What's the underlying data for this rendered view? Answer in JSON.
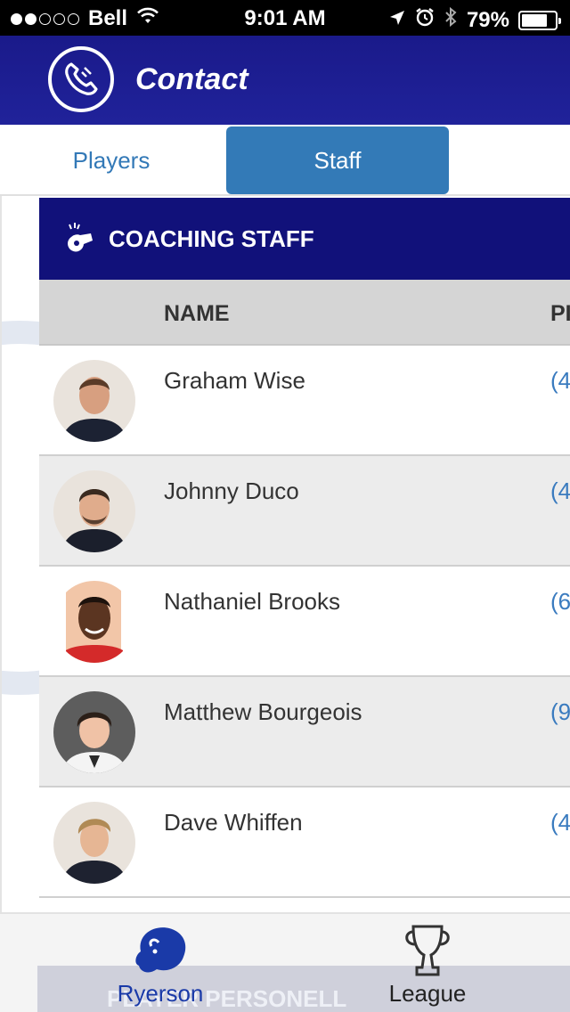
{
  "status_bar": {
    "carrier": "Bell",
    "time": "9:01 AM",
    "battery": "79%",
    "battery_level": 0.79
  },
  "header": {
    "title": "Contact",
    "icon": "phone-icon"
  },
  "tabs": [
    {
      "label": "Players",
      "active": false
    },
    {
      "label": "Staff",
      "active": true
    }
  ],
  "section": {
    "title": "COACHING STAFF",
    "icon": "whistle-icon"
  },
  "table": {
    "columns": [
      "NAME",
      "PI"
    ],
    "rows": [
      {
        "name": "Graham Wise",
        "phone": "(4"
      },
      {
        "name": "Johnny Duco",
        "phone": "(4"
      },
      {
        "name": "Nathaniel Brooks",
        "phone": "(6"
      },
      {
        "name": "Matthew Bourgeois",
        "phone": "(9"
      },
      {
        "name": "Dave Whiffen",
        "phone": "(4"
      }
    ]
  },
  "next_section": {
    "title": "PLAYER PERSONELL"
  },
  "bottom_nav": [
    {
      "label": "Ryerson",
      "icon": "ryerson-ram-icon"
    },
    {
      "label": "League",
      "icon": "trophy-icon"
    }
  ],
  "colors": {
    "header_blue": "#1a1a8a",
    "tab_active": "#337ab7",
    "link_blue": "#3a7bbf"
  }
}
